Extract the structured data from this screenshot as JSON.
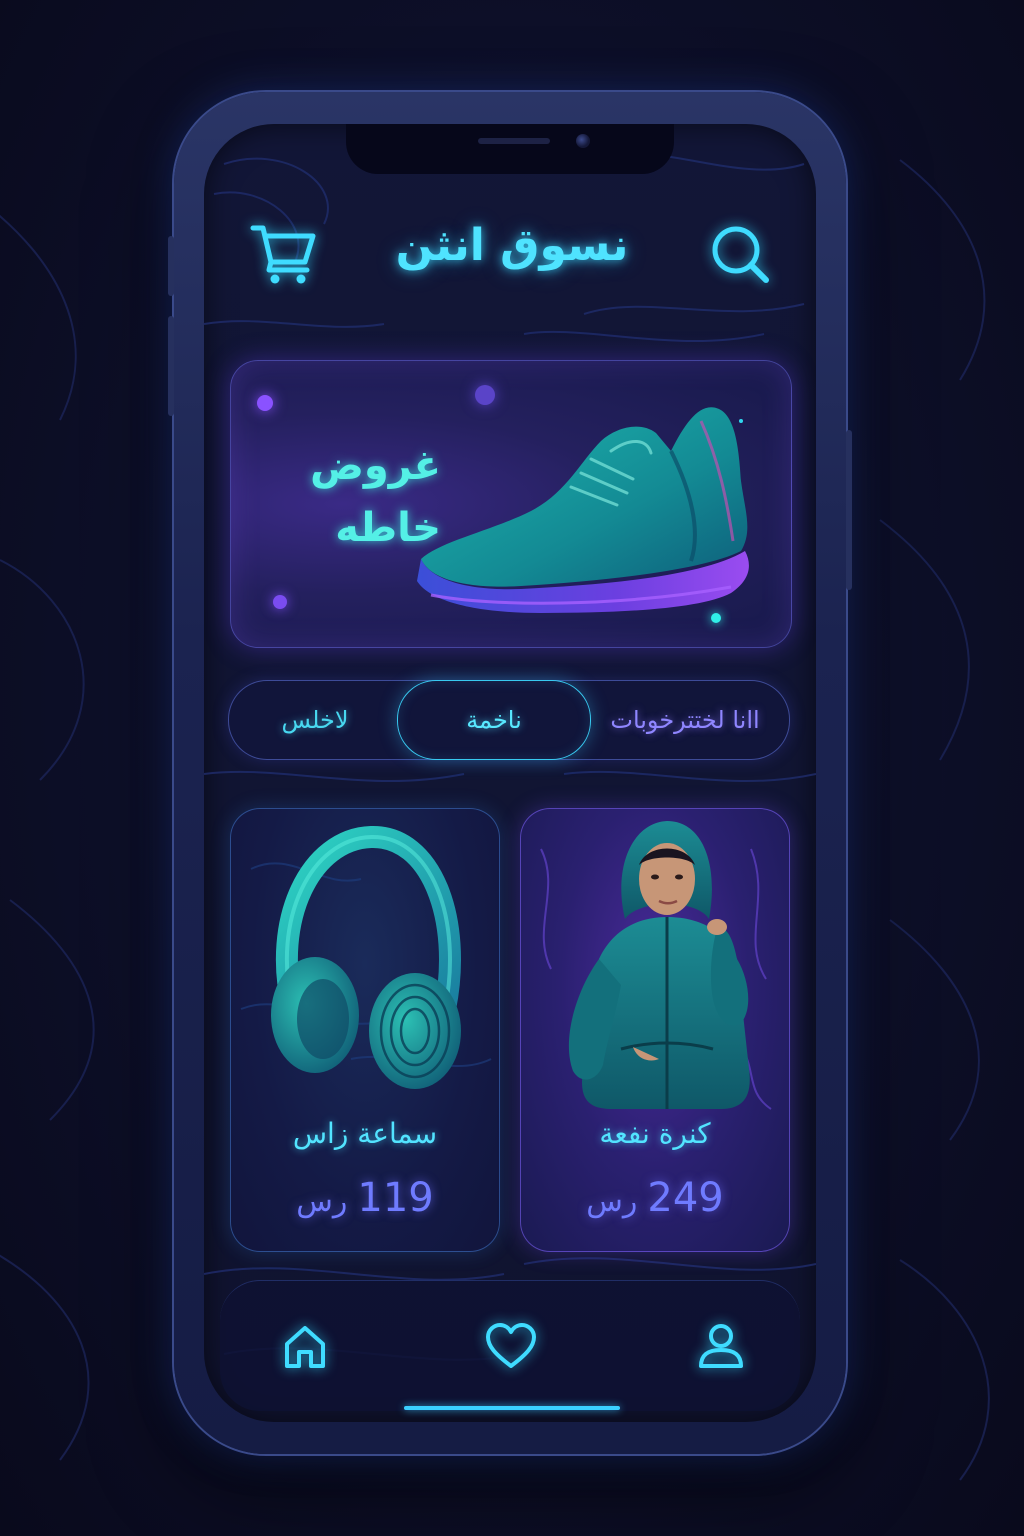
{
  "app": {
    "title": "نسوق انثن"
  },
  "header": {
    "cart_icon": "cart-icon",
    "search_icon": "search-icon"
  },
  "banner": {
    "line1": "غروض",
    "line2": "خاطه",
    "image": "sneaker"
  },
  "categories": [
    {
      "label": "اانا لختترخوبات",
      "selected": false
    },
    {
      "label": "ناخمة",
      "selected": true
    },
    {
      "label": "لاخلس",
      "selected": false
    }
  ],
  "products": [
    {
      "name": "سماعة زاس",
      "price": "119",
      "currency": "رس",
      "image": "headphones"
    },
    {
      "name": "كنرة نفعة",
      "price": "249",
      "currency": "رس",
      "image": "hoodie"
    }
  ],
  "nav": [
    {
      "icon": "home-icon"
    },
    {
      "icon": "heart-icon"
    },
    {
      "icon": "user-icon"
    }
  ],
  "colors": {
    "accent_cyan": "#4fe3ff",
    "accent_purple": "#6f7bff",
    "background": "#0c0d24",
    "screen": "#121637"
  }
}
